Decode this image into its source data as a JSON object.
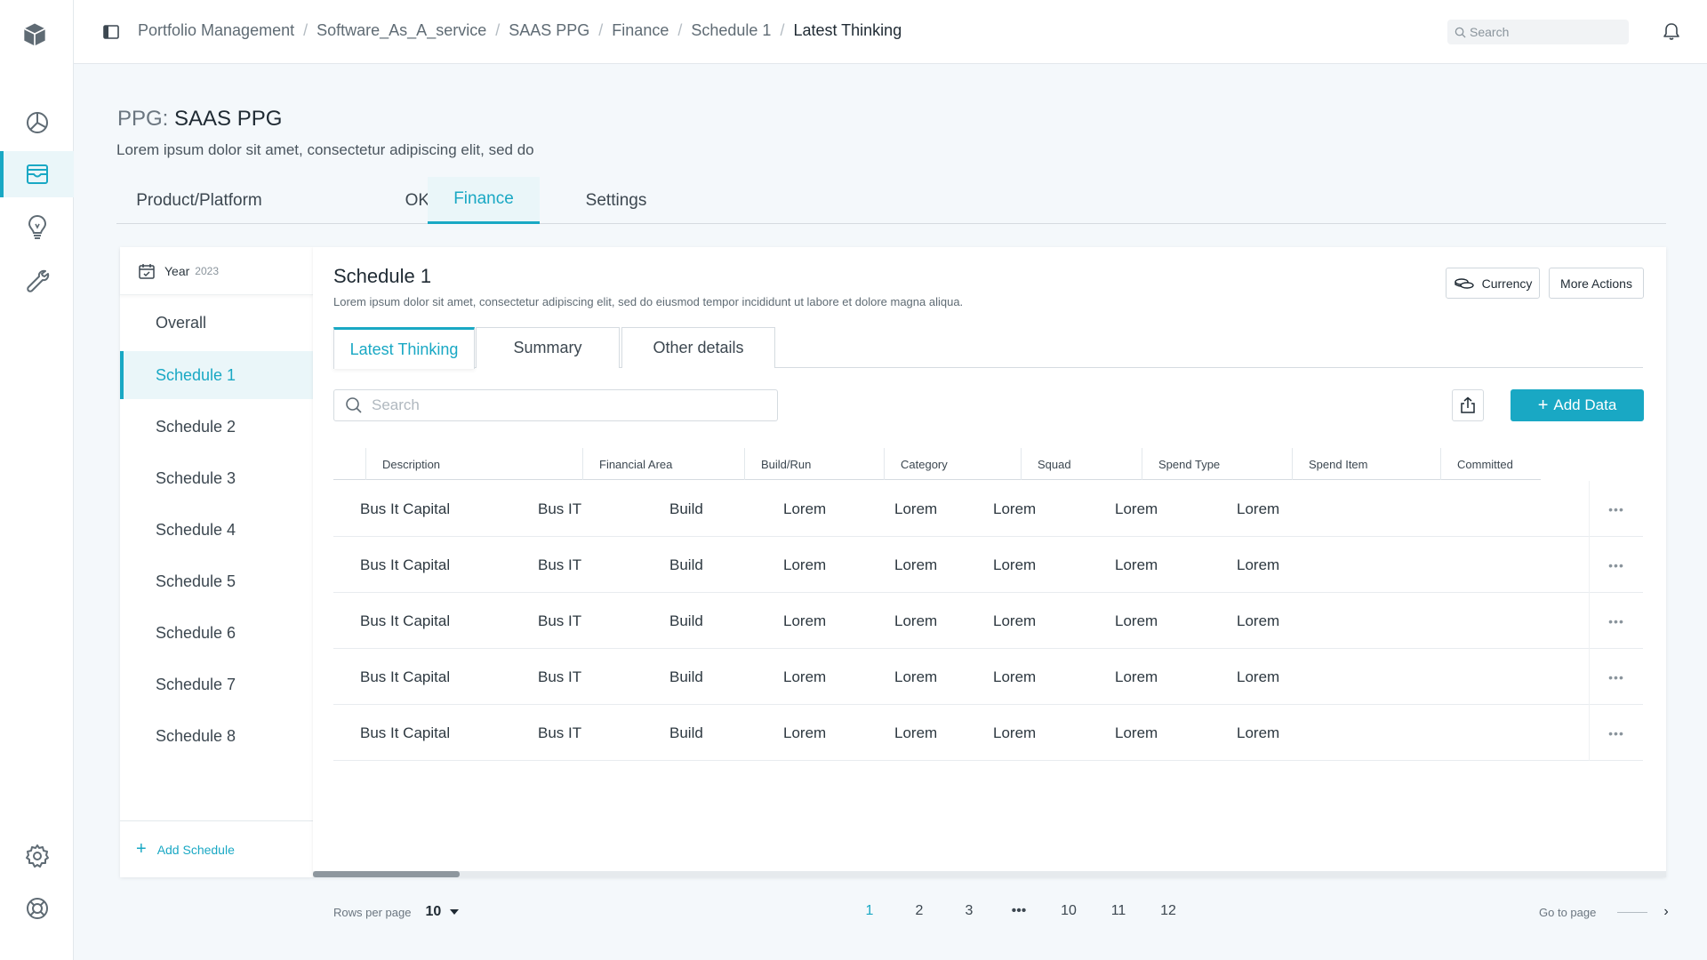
{
  "breadcrumb": [
    "Portfolio Management",
    "Software_As_A_service",
    "SAAS PPG",
    "Finance",
    "Schedule 1",
    "Latest Thinking"
  ],
  "search_top": {
    "placeholder": "Search"
  },
  "page": {
    "title_prefix": "PPG:",
    "title_name": "SAAS PPG",
    "description": "Lorem ipsum dolor sit amet, consectetur adipiscing elit, sed do"
  },
  "main_tabs": [
    "Product/Platform",
    "OKRs",
    "Finance",
    "Settings"
  ],
  "main_tab_active": "Finance",
  "schedule_panel": {
    "year_label": "Year",
    "year_value": "2023",
    "items": [
      "Overall",
      "Schedule 1",
      "Schedule 2",
      "Schedule 3",
      "Schedule 4",
      "Schedule 5",
      "Schedule 6",
      "Schedule 7",
      "Schedule 8"
    ],
    "active": "Schedule 1",
    "add_label": "Add Schedule"
  },
  "content": {
    "title": "Schedule 1",
    "description": "Lorem ipsum dolor sit amet, consectetur adipiscing elit, sed do eiusmod tempor incididunt ut labore et dolore magna aliqua.",
    "currency_label": "Currency",
    "more_actions_label": "More Actions",
    "tabs": [
      "Latest Thinking",
      "Summary",
      "Other details"
    ],
    "active_tab": "Latest Thinking",
    "search_placeholder": "Search",
    "add_data_label": "Add Data"
  },
  "table": {
    "headers": [
      "Description",
      "Financial Area",
      "Build/Run",
      "Category",
      "Squad",
      "Spend Type",
      "Spend Item",
      "Committed"
    ],
    "rows": [
      [
        "Bus It Capital",
        "Bus IT",
        "Build",
        "Lorem",
        "Lorem",
        "Lorem",
        "Lorem",
        "Lorem"
      ],
      [
        "Bus It Capital",
        "Bus IT",
        "Build",
        "Lorem",
        "Lorem",
        "Lorem",
        "Lorem",
        "Lorem"
      ],
      [
        "Bus It Capital",
        "Bus IT",
        "Build",
        "Lorem",
        "Lorem",
        "Lorem",
        "Lorem",
        "Lorem"
      ],
      [
        "Bus It Capital",
        "Bus IT",
        "Build",
        "Lorem",
        "Lorem",
        "Lorem",
        "Lorem",
        "Lorem"
      ],
      [
        "Bus It Capital",
        "Bus IT",
        "Build",
        "Lorem",
        "Lorem",
        "Lorem",
        "Lorem",
        "Lorem"
      ]
    ]
  },
  "pagination": {
    "rows_per_page_label": "Rows per page",
    "rows_per_page_value": "10",
    "pages": [
      "1",
      "2",
      "3",
      "•••",
      "10",
      "11",
      "12"
    ],
    "current": "1",
    "goto_label": "Go to page"
  },
  "colors": {
    "accent": "#19a8c4",
    "active_bg": "#eaf6f9"
  }
}
